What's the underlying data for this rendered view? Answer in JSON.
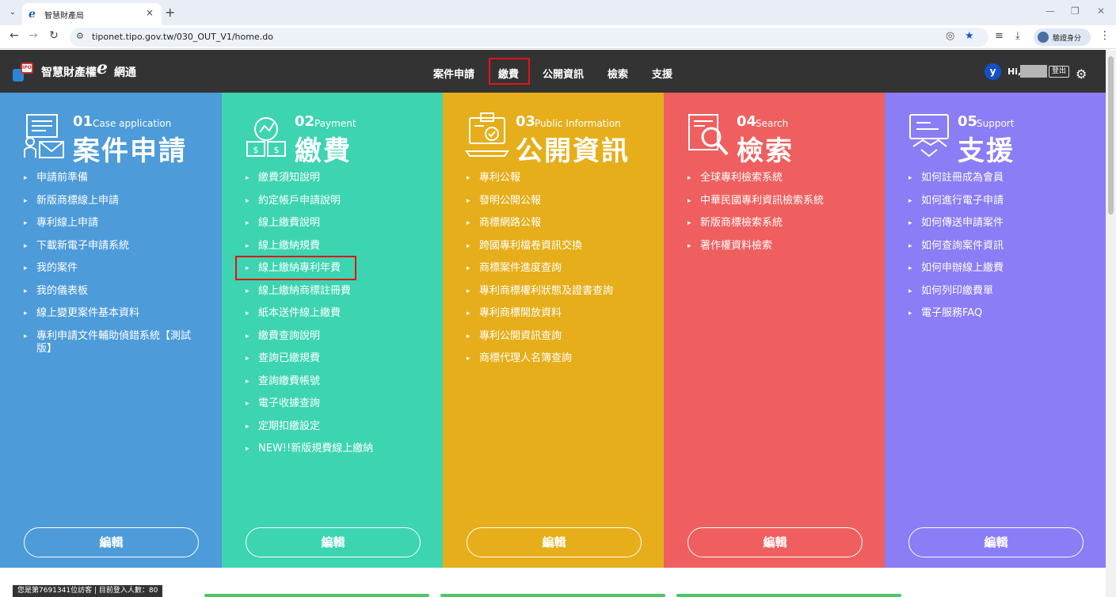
{
  "browser": {
    "tab_title": "智慧財產局",
    "tab_switch": "⌄",
    "url": "tiponet.tipo.gov.tw/030_OUT_V1/home.do",
    "profile_label": "驗證身分",
    "new_tab": "+",
    "close_tab": "×"
  },
  "header": {
    "logo_text": "智慧財產權",
    "logo_e": "e",
    "logo_text2": "網通",
    "nav": [
      "案件申請",
      "繳費",
      "公開資訊",
      "檢索",
      "支援"
    ],
    "active_nav": "繳費",
    "user_initial": "y",
    "user_hi": "Hi,",
    "logout": "登出"
  },
  "columns": [
    {
      "num": "01",
      "en": "Case application",
      "title": "案件申請",
      "color": "#4d9bd9",
      "items": [
        "申請前準備",
        "新版商標線上申請",
        "專利線上申請",
        "下載新電子申請系統",
        "我的案件",
        "我的儀表板",
        "線上變更案件基本資料",
        "專利申請文件輔助偵錯系統【測試版】"
      ],
      "edit": "編輯"
    },
    {
      "num": "02",
      "en": "Payment",
      "title": "繳費",
      "color": "#3dd4b1",
      "items": [
        "繳費須知說明",
        "約定帳戶申請說明",
        "線上繳費說明",
        "線上繳納規費",
        "線上繳納專利年費",
        "線上繳納商標註冊費",
        "紙本送件線上繳費",
        "繳費查詢說明",
        "查詢已繳規費",
        "查詢繳費帳號",
        "電子收據查詢",
        "定期扣繳設定",
        "NEW!!新版規費線上繳納"
      ],
      "edit": "編輯"
    },
    {
      "num": "03",
      "en": "Public Information",
      "title": "公開資訊",
      "color": "#e5ae1a",
      "items": [
        "專利公報",
        "發明公開公報",
        "商標網路公報",
        "跨國專利檔卷資訊交換",
        "商標案件進度查詢",
        "專利商標權利狀態及證書查詢",
        "專利商標開放資料",
        "專利公開資訊查詢",
        "商標代理人名簿查詢"
      ],
      "edit": "編輯"
    },
    {
      "num": "04",
      "en": "Search",
      "title": "檢索",
      "color": "#ef5f5f",
      "items": [
        "全球專利檢索系統",
        "中華民國專利資訊檢索系統",
        "新版商標檢索系統",
        "著作權資料檢索"
      ],
      "edit": "編輯"
    },
    {
      "num": "05",
      "en": "Support",
      "title": "支援",
      "color": "#8a7df5",
      "items": [
        "如何註冊成為會員",
        "如何進行電子申請",
        "如何傳送申請案件",
        "如何查詢案件資訊",
        "如何申辦線上繳費",
        "如何列印繳費單",
        "電子服務FAQ"
      ],
      "edit": "編輯"
    }
  ],
  "footer": {
    "visitor_text": "您是第7691341位訪客 | 目前登入人數：80"
  }
}
